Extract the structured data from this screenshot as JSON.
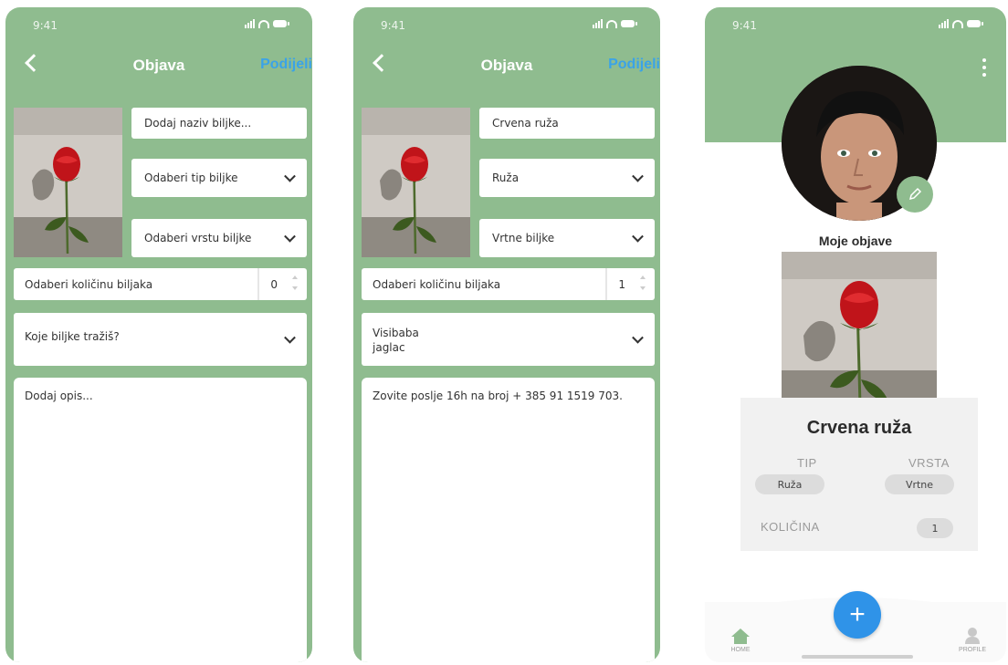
{
  "status": {
    "time": "9:41"
  },
  "screens": [
    {
      "nav": {
        "title": "Objava",
        "action": "Podijeli"
      },
      "name_field": "Dodaj naziv biljke...",
      "type_select": "Odaberi tip biljke",
      "kind_select": "Odaberi vrstu biljke",
      "qty_label": "Odaberi količinu biljaka",
      "qty_value": "0",
      "seek": {
        "line1": "Koje biljke tražiš?",
        "line2": ""
      },
      "description": "Dodaj opis..."
    },
    {
      "nav": {
        "title": "Objava",
        "action": "Podijeli"
      },
      "name_field": "Crvena ruža",
      "type_select": "Ruža",
      "kind_select": "Vrtne biljke",
      "qty_label": "Odaberi količinu biljaka",
      "qty_value": "1",
      "seek": {
        "line1": "Visibaba",
        "line2": "jaglac"
      },
      "description": "Zovite poslje 16h na broj + 385 91 1519 703."
    }
  ],
  "profile": {
    "section_title": "Moje objave",
    "post": {
      "title": "Crvena ruža",
      "type_label": "TIP",
      "type_value": "Ruža",
      "kind_label": "VRSTA",
      "kind_value": "Vrtne",
      "qty_label": "KOLIČINA",
      "qty_value": "1"
    },
    "fab": "+",
    "tabs": {
      "home": "HOME",
      "profile": "PROFILE"
    }
  },
  "icons": [
    "back-chevron-icon",
    "chevron-down-icon",
    "signal-icon",
    "wifi-icon",
    "battery-icon",
    "more-vertical-icon",
    "pencil-icon",
    "home-icon",
    "person-icon",
    "plus-icon"
  ],
  "colors": {
    "header_green": "#8fbc8f",
    "accent_blue": "#2f93e8",
    "share_blue": "#3aa3e8"
  }
}
